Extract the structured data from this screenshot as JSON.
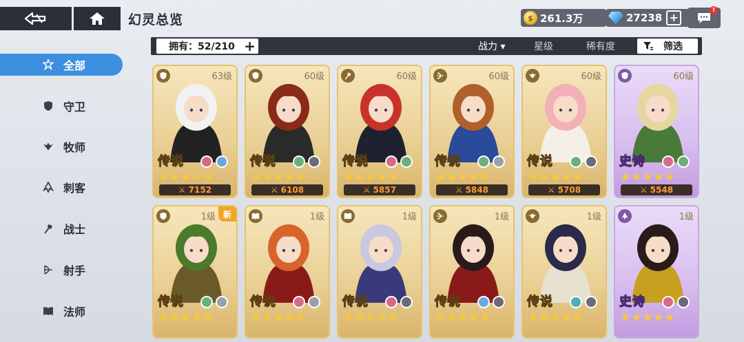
{
  "header": {
    "title": "幻灵总览",
    "gold": "261.3万",
    "gems": "27238",
    "chat_badge": "!"
  },
  "filter": {
    "owned_label": "拥有：52/210",
    "sort_power": "战力",
    "sort_power_arrow": "▾",
    "sort_stars": "星级",
    "sort_rarity": "稀有度",
    "filter_label": "筛选"
  },
  "sidebar": {
    "items": [
      {
        "label": "全部",
        "icon": "all-icon",
        "active": true
      },
      {
        "label": "守卫",
        "icon": "guard-shield-icon"
      },
      {
        "label": "牧师",
        "icon": "priest-wings-icon"
      },
      {
        "label": "刺客",
        "icon": "assassin-icon"
      },
      {
        "label": "战士",
        "icon": "warrior-axe-icon"
      },
      {
        "label": "射手",
        "icon": "archer-bow-icon"
      },
      {
        "label": "法师",
        "icon": "mage-book-icon"
      }
    ]
  },
  "cards": [
    {
      "level": "63级",
      "rarity": "传说",
      "stars": 5,
      "power": "7152",
      "tier": "legend",
      "elements": [
        "#d76a8a",
        "#6aa8e0"
      ],
      "class_icon": "guard-shield-icon",
      "hair": "#f2f2f2",
      "outfit": "#222"
    },
    {
      "level": "60级",
      "rarity": "传说",
      "stars": 5,
      "power": "6108",
      "tier": "legend",
      "elements": [
        "#6ab07a",
        "#6a6a7a"
      ],
      "class_icon": "guard-shield-icon",
      "hair": "#8a2a1a",
      "outfit": "#2a2a2a"
    },
    {
      "level": "60级",
      "rarity": "传说",
      "stars": 5,
      "power": "5857",
      "tier": "legend",
      "elements": [
        "#d76a8a",
        "#6ab07a"
      ],
      "class_icon": "warrior-axe-icon",
      "hair": "#c8322a",
      "outfit": "#1e2230"
    },
    {
      "level": "60级",
      "rarity": "传说",
      "stars": 5,
      "power": "5848",
      "tier": "legend",
      "elements": [
        "#6ab07a",
        "#9aa0aa"
      ],
      "class_icon": "archer-bow-icon",
      "hair": "#b0602a",
      "outfit": "#2a4a9a"
    },
    {
      "level": "60级",
      "rarity": "传说",
      "stars": 5,
      "power": "5708",
      "tier": "legend",
      "elements": [
        "#6ab07a",
        "#6a6a7a"
      ],
      "class_icon": "priest-wings-icon",
      "hair": "#f2b0b8",
      "outfit": "#f4f0e8"
    },
    {
      "level": "60级",
      "rarity": "史诗",
      "stars": 5,
      "power": "5548",
      "tier": "epic",
      "elements": [
        "#d76a8a",
        "#6ab07a"
      ],
      "class_icon": "guard-shield-icon",
      "hair": "#e6d6a0",
      "outfit": "#4a7a3a"
    },
    {
      "level": "1级",
      "rarity": "传说",
      "stars": 5,
      "power": "",
      "tier": "legend",
      "elements": [
        "#6ab07a",
        "#9aa0aa"
      ],
      "class_icon": "guard-shield-icon",
      "hair": "#4a7a2a",
      "outfit": "#6a5a2a",
      "new": "新"
    },
    {
      "level": "1级",
      "rarity": "传说",
      "stars": 5,
      "power": "",
      "tier": "legend",
      "elements": [
        "#d76a8a",
        "#9aa0aa"
      ],
      "class_icon": "mage-book-icon",
      "hair": "#d8642a",
      "outfit": "#8a1a1a"
    },
    {
      "level": "1级",
      "rarity": "传说",
      "stars": 5,
      "power": "",
      "tier": "legend",
      "elements": [
        "#d76a8a",
        "#6a6a7a"
      ],
      "class_icon": "mage-book-icon",
      "hair": "#c8c8e0",
      "outfit": "#3a3a7a"
    },
    {
      "level": "1级",
      "rarity": "传说",
      "stars": 5,
      "power": "",
      "tier": "legend",
      "elements": [
        "#6aa8e0",
        "#6a6a7a"
      ],
      "class_icon": "archer-bow-icon",
      "hair": "#2a1a1a",
      "outfit": "#8a1a1a"
    },
    {
      "level": "1级",
      "rarity": "传说",
      "stars": 5,
      "power": "",
      "tier": "legend",
      "elements": [
        "#4ab0b0",
        "#6a6a7a"
      ],
      "class_icon": "priest-wings-icon",
      "hair": "#2a2a4a",
      "outfit": "#e8e0d0"
    },
    {
      "level": "1级",
      "rarity": "史诗",
      "stars": 5,
      "power": "",
      "tier": "epic",
      "elements": [
        "#d76a8a",
        "#6a6a7a"
      ],
      "class_icon": "assassin-icon",
      "hair": "#2a1a1a",
      "outfit": "#c8a020"
    }
  ]
}
